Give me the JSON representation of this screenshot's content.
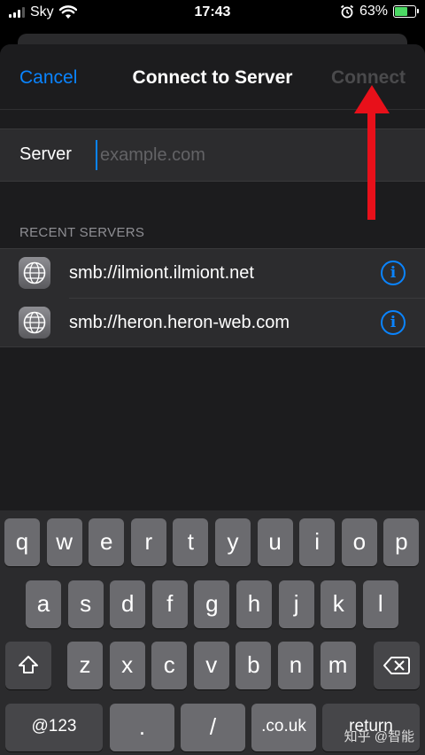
{
  "status": {
    "carrier": "Sky",
    "time": "17:43",
    "battery": "63%",
    "battery_level": 0.63
  },
  "nav": {
    "cancel": "Cancel",
    "title": "Connect to Server",
    "connect": "Connect"
  },
  "server": {
    "label": "Server",
    "placeholder": "example.com",
    "value": ""
  },
  "recent": {
    "header": "RECENT SERVERS",
    "items": [
      {
        "address": "smb://ilmiont.ilmiont.net"
      },
      {
        "address": "smb://heron.heron-web.com"
      }
    ]
  },
  "keyboard": {
    "row1": [
      "q",
      "w",
      "e",
      "r",
      "t",
      "y",
      "u",
      "i",
      "o",
      "p"
    ],
    "row2": [
      "a",
      "s",
      "d",
      "f",
      "g",
      "h",
      "j",
      "k",
      "l"
    ],
    "row3": [
      "z",
      "x",
      "c",
      "v",
      "b",
      "n",
      "m"
    ],
    "row4": {
      "numbers": "@123",
      "dot": ".",
      "slash": "/",
      "domain": ".co.uk",
      "return": "return"
    }
  },
  "watermark": "知乎 @智能",
  "colors": {
    "accent": "#0a84ff",
    "annotation": "#e8101a",
    "battery": "#4cd964"
  },
  "icons": {
    "wifi": "wifi-icon",
    "alarm": "alarm-icon",
    "server": "globe-network-icon",
    "info": "info-circle-icon",
    "shift": "shift-arrow-icon",
    "delete": "backspace-icon"
  }
}
